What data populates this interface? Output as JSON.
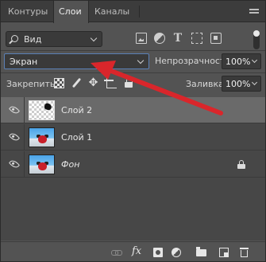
{
  "tabs": [
    {
      "label": "Контуры"
    },
    {
      "label": "Слои"
    },
    {
      "label": "Каналы"
    }
  ],
  "filter": {
    "label": "Вид"
  },
  "blend_mode": {
    "value": "Экран"
  },
  "opacity": {
    "label": "Непрозрачность:",
    "value": "100%"
  },
  "lock": {
    "label": "Закрепить:"
  },
  "fill": {
    "label": "Заливка:",
    "value": "100%"
  },
  "layers": [
    {
      "name": "Слой 2",
      "selected": true,
      "visible": true
    },
    {
      "name": "Слой 1",
      "selected": false,
      "visible": true
    },
    {
      "name": "Фон",
      "selected": false,
      "visible": true,
      "locked": true
    }
  ],
  "colors": {
    "panel_bg": "#535353",
    "selected_row": "#6a6a6a",
    "annotation_arrow": "#d9262b"
  },
  "icons": {
    "filter": [
      "image-filter-icon",
      "adjustment-filter-icon",
      "type-filter-icon",
      "shape-filter-icon",
      "smart-object-filter-icon"
    ],
    "lock": [
      "lock-transparent-pixels-icon",
      "lock-image-pixels-icon",
      "lock-position-icon",
      "lock-artboard-icon",
      "lock-all-icon"
    ],
    "footer": [
      "link-layers-icon",
      "fx-icon",
      "add-mask-icon",
      "new-adjustment-layer-icon",
      "new-group-icon",
      "new-layer-icon",
      "delete-layer-icon"
    ]
  }
}
